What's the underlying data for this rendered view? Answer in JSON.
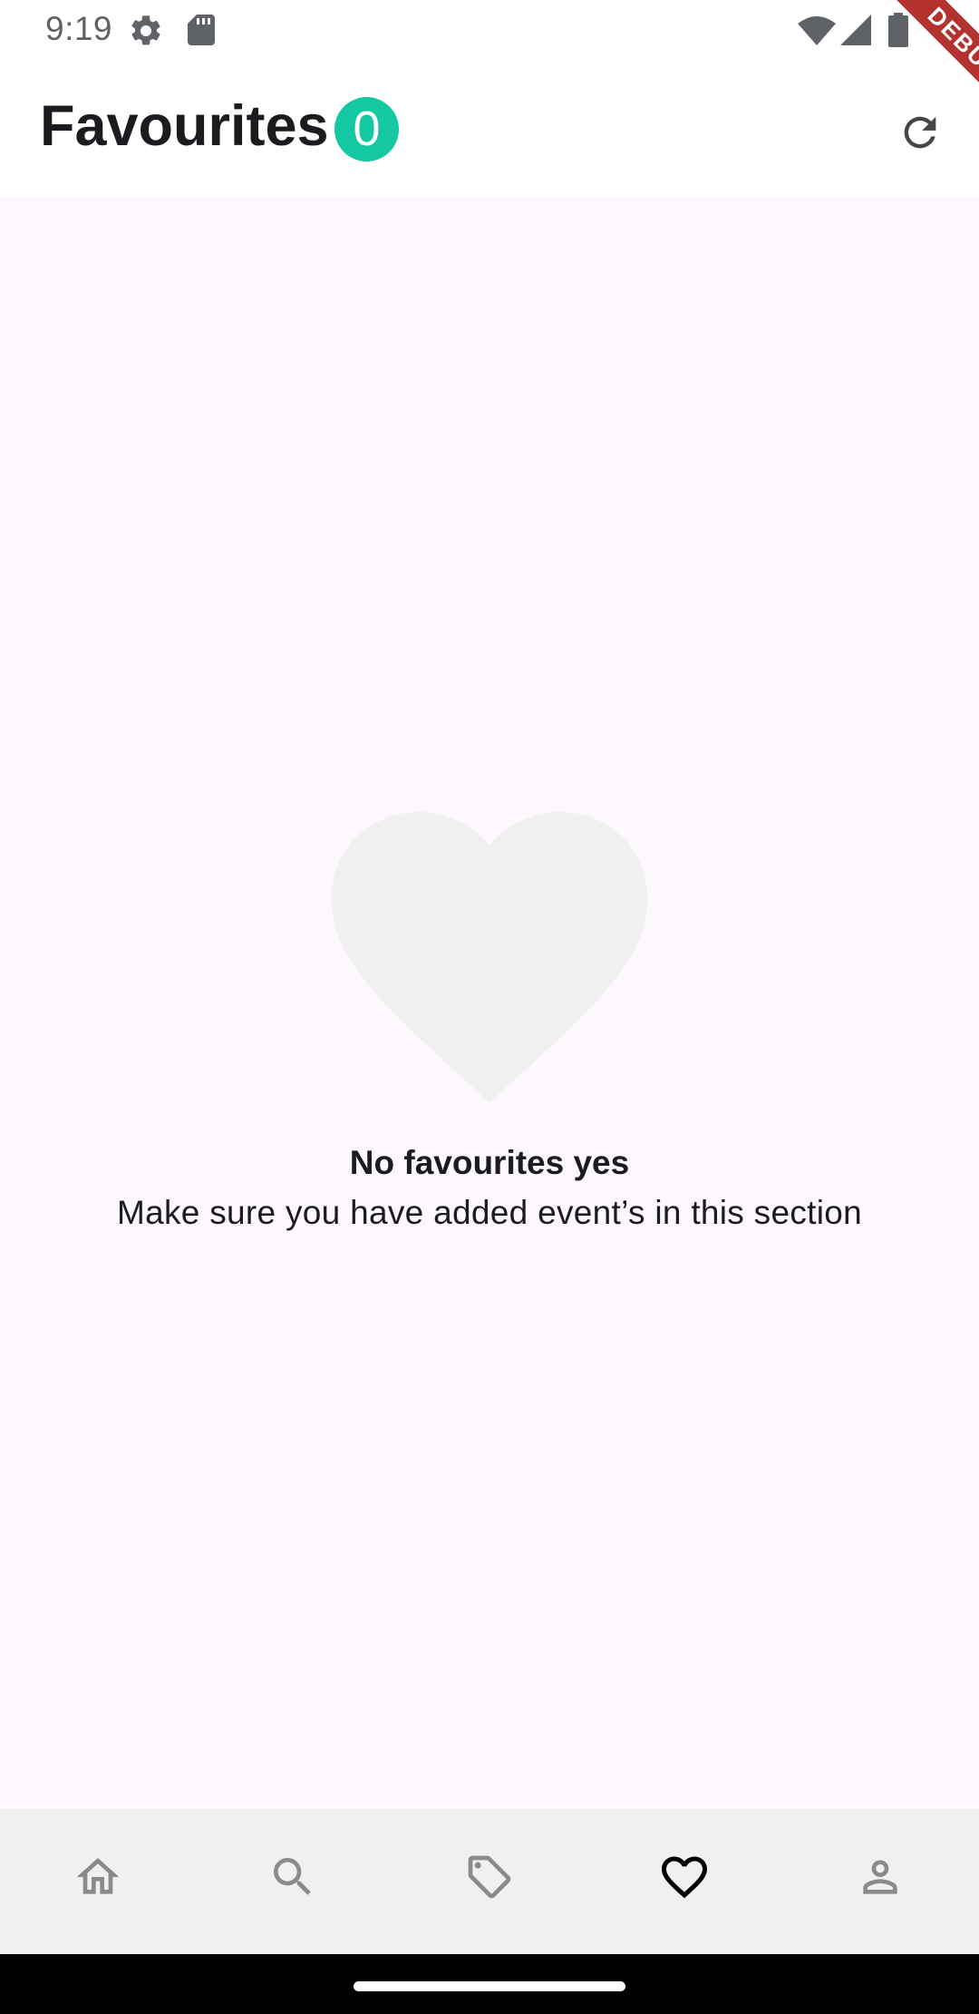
{
  "status_bar": {
    "time": "9:19",
    "icons": [
      "settings-gear-icon",
      "sd-card-icon",
      "wifi-icon",
      "cell-signal-icon",
      "battery-icon"
    ]
  },
  "debug_banner": "DEBUG",
  "app_bar": {
    "title": "Favourites",
    "count": "0",
    "badge_color": "#14c9a1",
    "refresh_icon": "refresh-icon"
  },
  "empty_state": {
    "icon": "heart-icon",
    "title": "No favourites yes",
    "message": "Make sure you have added event’s in this section"
  },
  "bottom_nav": {
    "items": [
      {
        "icon": "home-icon",
        "active": false
      },
      {
        "icon": "search-icon",
        "active": false
      },
      {
        "icon": "tag-icon",
        "active": false
      },
      {
        "icon": "heart-icon",
        "active": true
      },
      {
        "icon": "person-icon",
        "active": false
      }
    ]
  },
  "colors": {
    "background": "#fdf8fd",
    "nav_background": "#f0f0f0",
    "inactive_icon": "#8a8a8a",
    "active_icon": "#000000"
  }
}
